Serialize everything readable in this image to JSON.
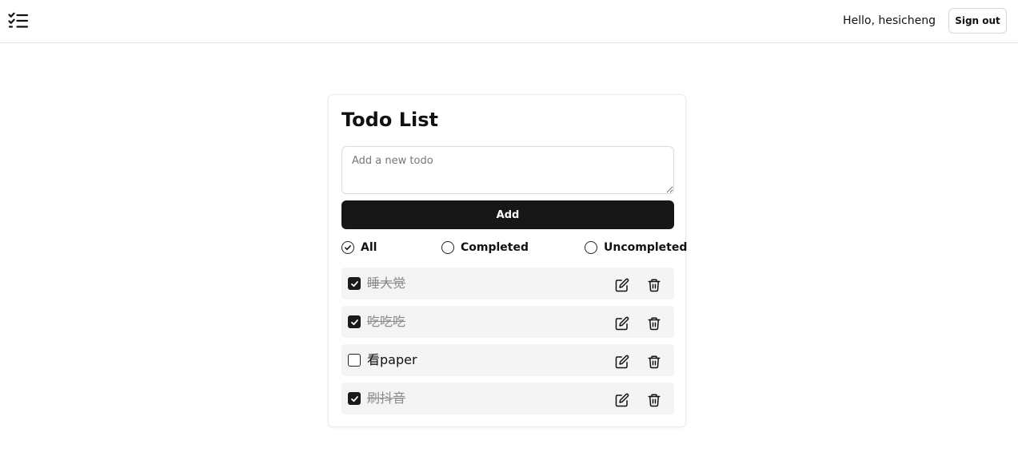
{
  "header": {
    "logo_icon": "list-checks-icon",
    "greeting": "Hello, hesicheng",
    "signout_label": "Sign out"
  },
  "card": {
    "title": "Todo List",
    "input_placeholder": "Add a new todo",
    "input_value": "",
    "add_label": "Add",
    "filters": [
      {
        "label": "All",
        "selected": true
      },
      {
        "label": "Completed",
        "selected": false
      },
      {
        "label": "Uncompleted",
        "selected": false
      }
    ],
    "todos": [
      {
        "text": "睡大觉",
        "completed": true
      },
      {
        "text": "吃吃吃",
        "completed": true
      },
      {
        "text": "看paper",
        "completed": false
      },
      {
        "text": "刷抖音",
        "completed": true
      }
    ],
    "item_icons": {
      "edit": "edit-icon",
      "delete": "trash-icon"
    }
  },
  "colors": {
    "primary": "#171717",
    "item_background": "#f4f4f4",
    "completed_text": "#8a8a8a",
    "border": "#e5e5e5"
  }
}
